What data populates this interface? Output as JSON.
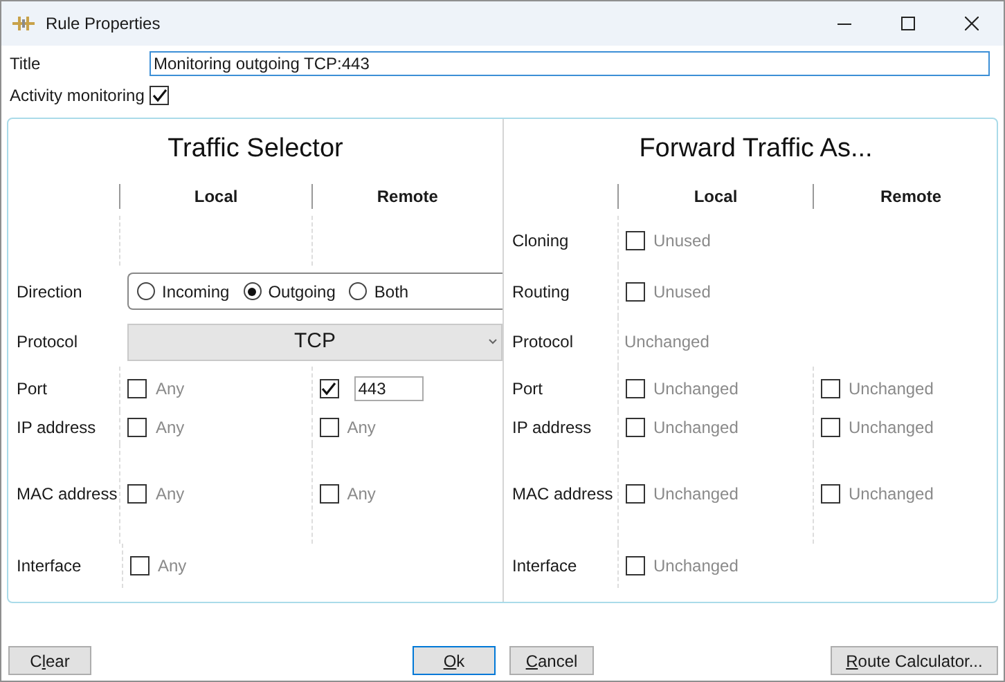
{
  "window": {
    "title": "Rule Properties"
  },
  "title_field": {
    "label": "Title",
    "value": "Monitoring outgoing TCP:443"
  },
  "activity_monitoring": {
    "label": "Activity monitoring",
    "checked": true
  },
  "traffic_selector": {
    "heading": "Traffic Selector",
    "columns": [
      "Local",
      "Remote"
    ],
    "rows": [
      {
        "label": "Direction",
        "kind": "radio",
        "options": [
          {
            "label": "Incoming",
            "selected": false
          },
          {
            "label": "Outgoing",
            "selected": true
          },
          {
            "label": "Both",
            "selected": false
          }
        ]
      },
      {
        "label": "Protocol",
        "kind": "dropdown",
        "value": "TCP"
      },
      {
        "label": "Port",
        "kind": "checks",
        "local": {
          "checked": false,
          "text": "Any"
        },
        "remote": {
          "checked": true,
          "value": "443"
        }
      },
      {
        "label": "IP address",
        "kind": "checks",
        "local": {
          "checked": false,
          "text": "Any"
        },
        "remote": {
          "checked": false,
          "text": "Any"
        }
      },
      {
        "label": "MAC address",
        "kind": "checks",
        "local": {
          "checked": false,
          "text": "Any"
        },
        "remote": {
          "checked": false,
          "text": "Any"
        }
      },
      {
        "label": "Interface",
        "kind": "checks",
        "local": {
          "checked": false,
          "text": "Any"
        }
      }
    ]
  },
  "forward_traffic": {
    "heading": "Forward Traffic As...",
    "columns": [
      "Local",
      "Remote"
    ],
    "rows": [
      {
        "label": "Cloning",
        "kind": "checks",
        "local": {
          "checked": false,
          "text": "Unused"
        }
      },
      {
        "label": "Routing",
        "kind": "checks",
        "local": {
          "checked": false,
          "text": "Unused"
        }
      },
      {
        "label": "Protocol",
        "kind": "text",
        "text": "Unchanged"
      },
      {
        "label": "Port",
        "kind": "checks",
        "local": {
          "checked": false,
          "text": "Unchanged"
        },
        "remote": {
          "checked": false,
          "text": "Unchanged"
        }
      },
      {
        "label": "IP address",
        "kind": "checks",
        "local": {
          "checked": false,
          "text": "Unchanged"
        },
        "remote": {
          "checked": false,
          "text": "Unchanged"
        }
      },
      {
        "label": "MAC address",
        "kind": "checks",
        "local": {
          "checked": false,
          "text": "Unchanged"
        },
        "remote": {
          "checked": false,
          "text": "Unchanged"
        }
      },
      {
        "label": "Interface",
        "kind": "checks",
        "local": {
          "checked": false,
          "text": "Unchanged"
        }
      }
    ]
  },
  "buttons": [
    {
      "before": "C",
      "access_key": "l",
      "after": "ear",
      "default": false
    },
    {
      "access_key": "O",
      "after": "k",
      "default": true
    },
    {
      "access_key": "C",
      "after": "ancel",
      "default": false
    },
    {
      "access_key": "R",
      "after": "oute Calculator...",
      "default": false
    }
  ]
}
